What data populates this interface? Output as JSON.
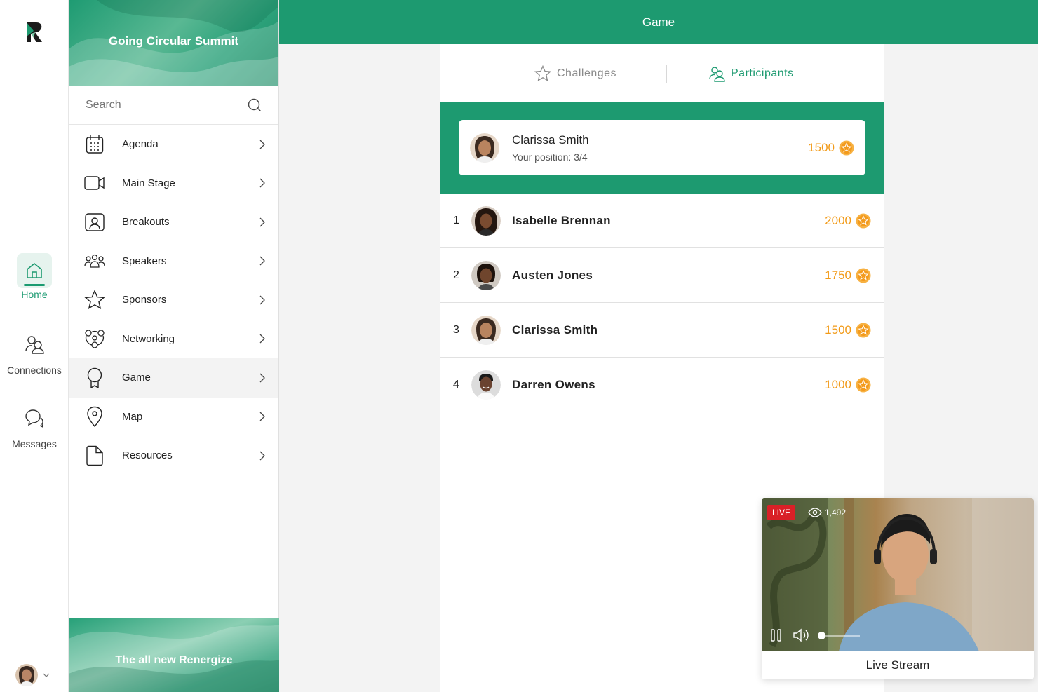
{
  "rail": {
    "items": [
      {
        "label": "Home",
        "icon": "home-icon",
        "active": true
      },
      {
        "label": "Connections",
        "icon": "connections-icon"
      },
      {
        "label": "Messages",
        "icon": "messages-icon"
      }
    ]
  },
  "event": {
    "title": "Going Circular Summit",
    "bottom_banner": "The all new Renergize"
  },
  "search": {
    "placeholder": "Search"
  },
  "nav": {
    "items": [
      {
        "label": "Agenda",
        "icon": "calendar-icon"
      },
      {
        "label": "Main Stage",
        "icon": "video-camera-icon"
      },
      {
        "label": "Breakouts",
        "icon": "breakout-icon"
      },
      {
        "label": "Speakers",
        "icon": "speakers-icon"
      },
      {
        "label": "Sponsors",
        "icon": "star-icon"
      },
      {
        "label": "Networking",
        "icon": "networking-icon"
      },
      {
        "label": "Game",
        "icon": "award-icon",
        "active": true
      },
      {
        "label": "Map",
        "icon": "map-pin-icon"
      },
      {
        "label": "Resources",
        "icon": "document-icon"
      }
    ]
  },
  "header": {
    "title": "Game"
  },
  "tabs": {
    "challenges": "Challenges",
    "participants": "Participants"
  },
  "me": {
    "name": "Clarissa Smith",
    "position": "Your position: 3/4",
    "score": "1500"
  },
  "leaderboard": [
    {
      "rank": "1",
      "name": "Isabelle Brennan",
      "score": "2000"
    },
    {
      "rank": "2",
      "name": "Austen Jones",
      "score": "1750"
    },
    {
      "rank": "3",
      "name": "Clarissa Smith",
      "score": "1500"
    },
    {
      "rank": "4",
      "name": "Darren Owens",
      "score": "1000"
    }
  ],
  "live": {
    "badge": "LIVE",
    "viewers": "1,492",
    "title": "Live Stream",
    "volume_level": 0
  },
  "colors": {
    "brand_green": "#1d9a70",
    "score_orange": "#f29a17",
    "live_red": "#d92027"
  }
}
